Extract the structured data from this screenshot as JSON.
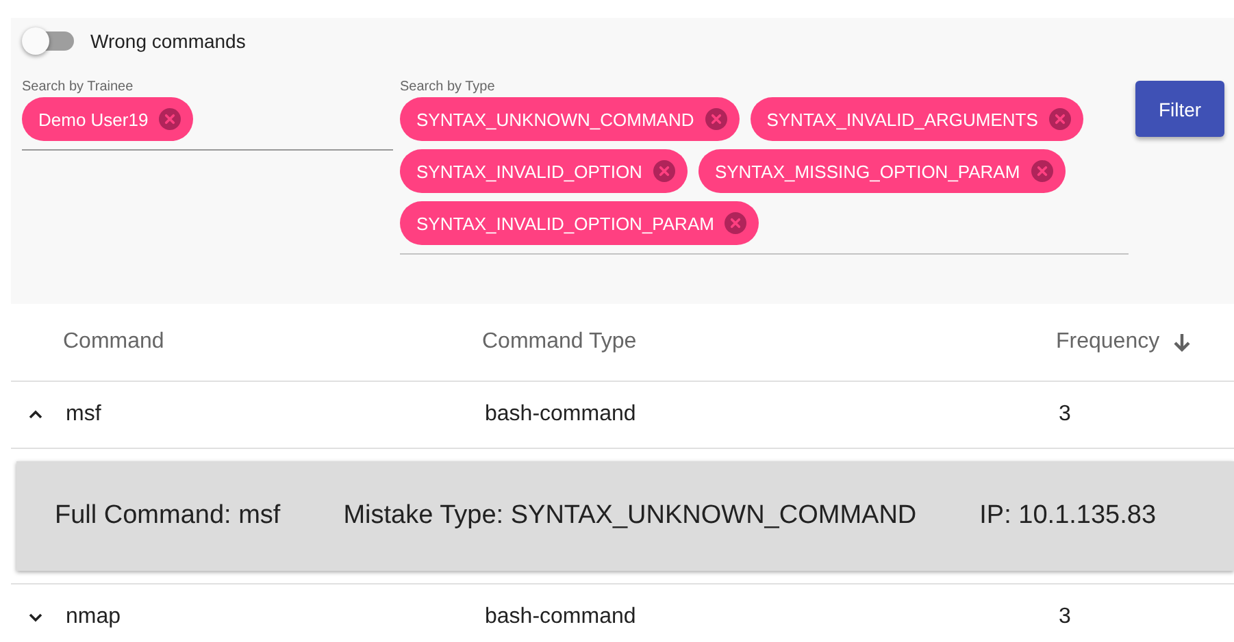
{
  "toggle": {
    "label": "Wrong commands",
    "on": false
  },
  "trainee_filter": {
    "label": "Search by Trainee",
    "chips": [
      "Demo User19"
    ]
  },
  "type_filter": {
    "label": "Search by Type",
    "chips": [
      "SYNTAX_UNKNOWN_COMMAND",
      "SYNTAX_INVALID_ARGUMENTS",
      "SYNTAX_INVALID_OPTION",
      "SYNTAX_MISSING_OPTION_PARAM",
      "SYNTAX_INVALID_OPTION_PARAM"
    ]
  },
  "filter_button": "Filter",
  "table": {
    "columns": [
      {
        "label": "Command",
        "sorted": false
      },
      {
        "label": "Command Type",
        "sorted": false
      },
      {
        "label": "Frequency",
        "sorted": true
      }
    ],
    "rows": [
      {
        "command": "msf",
        "type": "bash-command",
        "frequency": "3",
        "expanded": true,
        "details": [
          "Full Command: msf",
          "Mistake Type: SYNTAX_UNKNOWN_COMMAND",
          "IP: 10.1.135.83"
        ]
      },
      {
        "command": "nmap",
        "type": "bash-command",
        "frequency": "3",
        "expanded": false
      }
    ]
  }
}
